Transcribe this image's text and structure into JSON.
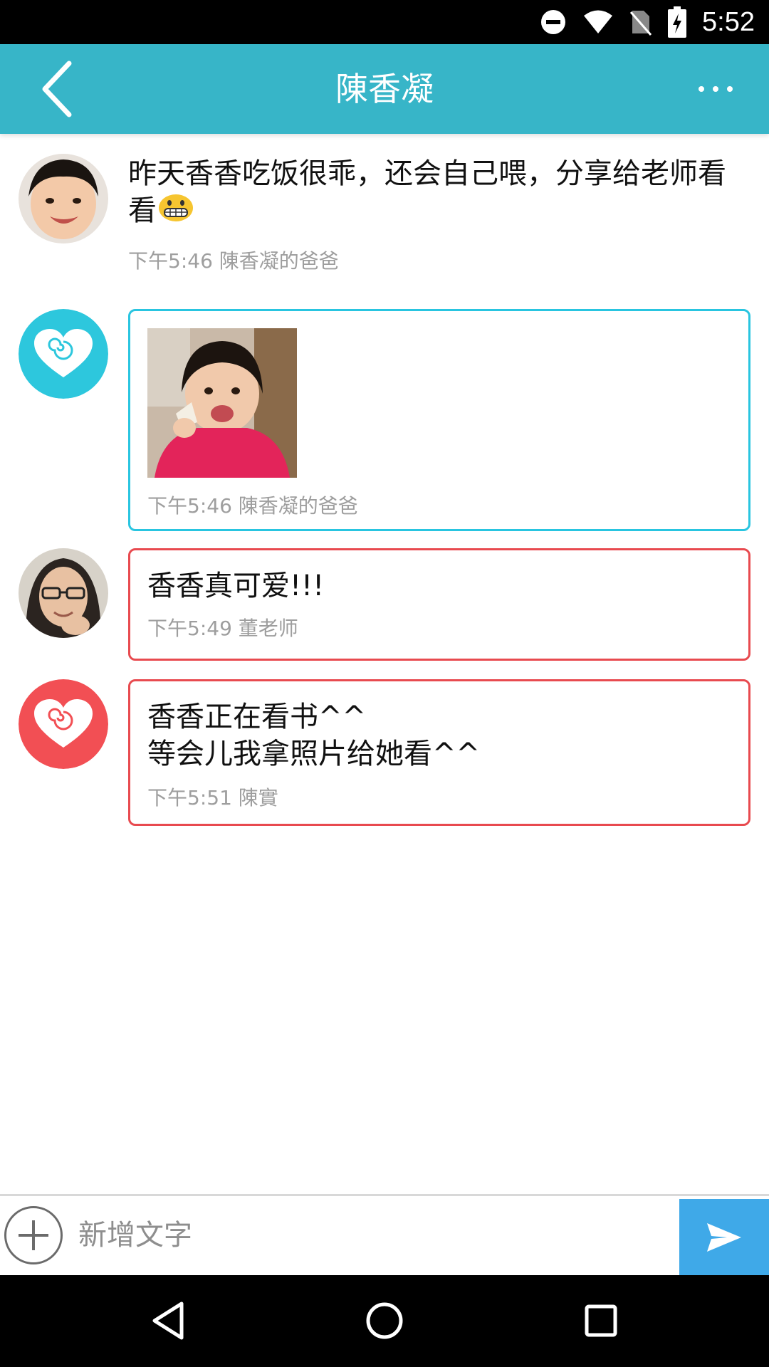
{
  "status_bar": {
    "time": "5:52",
    "icons": [
      "do-not-disturb-icon",
      "wifi-icon",
      "no-sim-icon",
      "battery-charging-icon"
    ]
  },
  "header": {
    "title": "陳香凝",
    "back_icon": "chevron-left-icon",
    "more_icon": "more-dots-icon"
  },
  "messages": [
    {
      "text": "昨天香香吃饭很乖，还会自己喂，分享给老师看看",
      "emoji": "grinning-face-emoji",
      "meta": "下午5:46 陳香凝的爸爸",
      "avatar": "child-photo-avatar"
    },
    {
      "image": "child-photo",
      "meta": "下午5:46 陳香凝的爸爸",
      "avatar": "heart-logo-avatar",
      "border_color": "#29c5e0"
    },
    {
      "text": "香香真可爱!!!",
      "meta": "下午5:49 董老师",
      "avatar": "teacher-photo-avatar",
      "border_color": "#e84a4f"
    },
    {
      "text_lines": [
        "香香正在看书^^",
        "等会儿我拿照片给她看^^"
      ],
      "meta": "下午5:51 陳實",
      "avatar": "heart-logo-avatar",
      "border_color": "#e84a4f"
    }
  ],
  "input_bar": {
    "placeholder": "新增文字",
    "add_icon": "plus-circle-icon",
    "send_icon": "send-arrow-icon"
  },
  "nav_bar": {
    "icons": [
      "back-triangle-icon",
      "home-circle-icon",
      "recents-square-icon"
    ]
  },
  "colors": {
    "accent": "#37b5c8",
    "blue_border": "#29c5e0",
    "red_border": "#e84a4f",
    "send_button": "#3fa9e8"
  }
}
